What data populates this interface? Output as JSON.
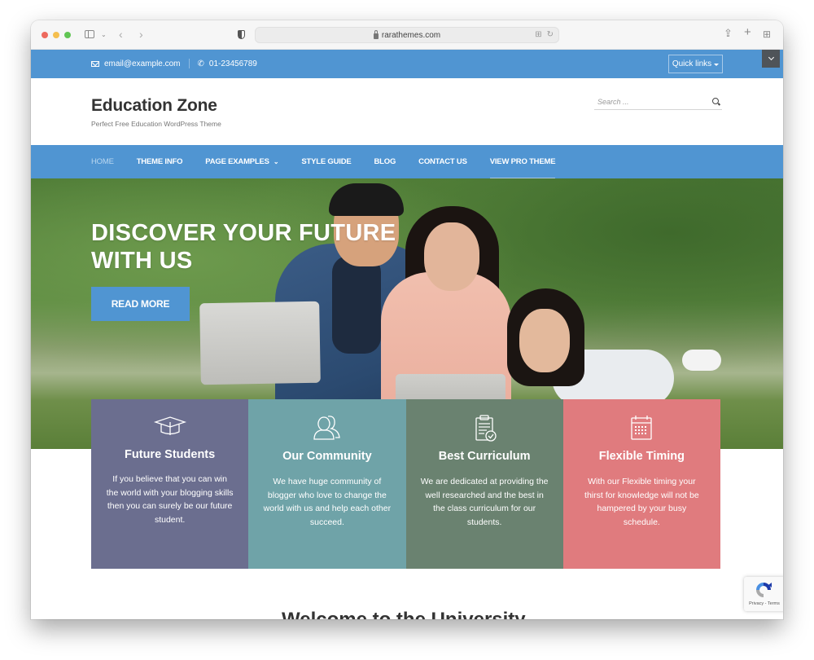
{
  "browser": {
    "url": "rarathemes.com",
    "traffic_lights": [
      "#ed6a5e",
      "#f5bf4f",
      "#61c554"
    ]
  },
  "topbar": {
    "email": "email@example.com",
    "phone": "01-23456789",
    "quick_links_label": "Quick links",
    "bg_color": "#5095d2"
  },
  "header": {
    "site_title": "Education Zone",
    "tagline": "Perfect Free Education WordPress Theme",
    "search_placeholder": "Search ..."
  },
  "nav": {
    "items": [
      {
        "label": "HOME",
        "active": true
      },
      {
        "label": "THEME INFO"
      },
      {
        "label": "PAGE EXAMPLES",
        "has_dropdown": true
      },
      {
        "label": "STYLE GUIDE"
      },
      {
        "label": "BLOG"
      },
      {
        "label": "CONTACT US"
      },
      {
        "label": "VIEW PRO THEME"
      }
    ],
    "dropdown_glyph": "⌄"
  },
  "hero": {
    "title": "DISCOVER YOUR FUTURE WITH US",
    "cta_label": "READ MORE"
  },
  "features": [
    {
      "icon": "graduation-cap-icon",
      "title": "Future Students",
      "text": "If you believe that you can win the world with your blogging skills then you can surely be our future student.",
      "color": "#6b6e8f"
    },
    {
      "icon": "community-icon",
      "title": "Our Community",
      "text": "We have huge community of blogger who love to change the world with us and help each other succeed.",
      "color": "#6fa3a8"
    },
    {
      "icon": "clipboard-check-icon",
      "title": "Best Curriculum",
      "text": "We are dedicated at providing the well researched and the best in the class curriculum for our students.",
      "color": "#6a8270"
    },
    {
      "icon": "calendar-icon",
      "title": "Flexible Timing",
      "text": "With our Flexible timing your thirst for knowledge will not be hampered by your busy schedule.",
      "color": "#e07b7e"
    }
  ],
  "welcome_heading": "Welcome to the University",
  "recaptcha": {
    "links": "Privacy - Terms"
  }
}
